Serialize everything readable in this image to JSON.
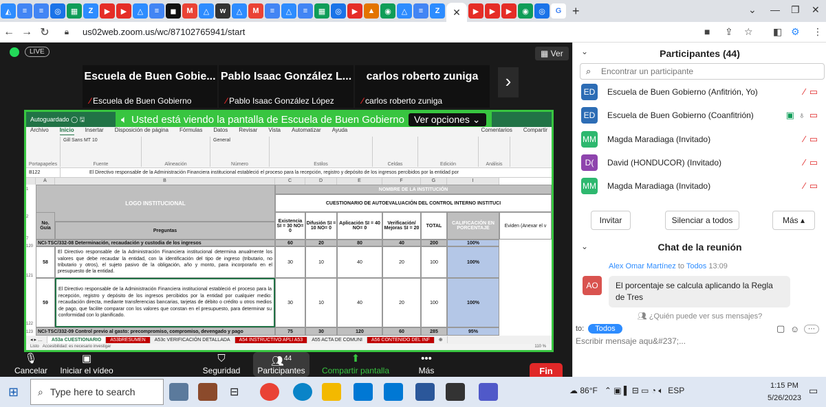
{
  "browser": {
    "url": "us02web.zoom.us/wc/87102765941/start",
    "new_tab": "+"
  },
  "zoom": {
    "live_label": "LIVE",
    "view_label": "Ver",
    "tiles": [
      {
        "big": "Escuela de Buen Gobie...",
        "small": "Escuela de Buen Gobierno"
      },
      {
        "big": "Pablo Isaac González L...",
        "small": "Pablo Isaac González López"
      },
      {
        "big": "carlos roberto zuniga",
        "small": "carlos roberto zuniga"
      }
    ],
    "share_banner": "Usted está viendo la pantalla de Escuela de Buen Gobierno",
    "view_options": "Ver opciones",
    "controls": {
      "mute": "Cancelar silenciar",
      "video": "Iniciar el vídeo",
      "security": "Seguridad",
      "participants": "Participantes",
      "participants_count": "44",
      "share": "Compartir pantalla",
      "more": "Más",
      "end": "Fin"
    }
  },
  "excel": {
    "autosave": "Autoguardado",
    "menu": [
      "Archivo",
      "Inicio",
      "Insertar",
      "Disposición de página",
      "Fórmulas",
      "Datos",
      "Revisar",
      "Vista",
      "Automatizar",
      "Ayuda"
    ],
    "comments": "Comentarios",
    "share": "Compartir",
    "ribbon_groups": [
      "Portapapeles",
      "Fuente",
      "Alineación",
      "Número",
      "Estilos",
      "Celdas",
      "Edición",
      "Análisis"
    ],
    "font_name": "Gill Sans MT",
    "font_size": "10",
    "number_format": "General",
    "cell_ref": "B122",
    "formula": "El Directivo responsable de la Administración Financiera institucional estableció el proceso para la recepción, registro y depósito de los ingresos percibidos por la entidad por",
    "columns": [
      "A",
      "B",
      "C",
      "D",
      "E",
      "F",
      "G",
      "I"
    ],
    "header_institution": "NOMBRE DE LA INSTITUCIÓN",
    "header_logo": "LOGO INSTITUCIONAL",
    "header_cuestionario": "CUESTIONARIO DE AUTOEVALUACIÓN DEL CONTROL INTERNO INSTITUCI",
    "col_headers": [
      "No. Guía",
      "Preguntas",
      "Existencia SI = 30 NO= 0",
      "Difusión SI = 10 NO= 0",
      "Aplicación SI = 40 NO= 0",
      "Verificación/ Mejoras SI = 20",
      "TOTAL",
      "CALIFICACIÓN EN PORCENTAJE",
      "Eviden (Anexar el v"
    ],
    "row_120": {
      "label": "NCI-TSC/332-08 Determinación, recaudación y custodia de los ingresos",
      "c": "60",
      "d": "20",
      "e": "80",
      "f": "40",
      "g": "200",
      "i": "100%"
    },
    "row_121": {
      "num": "58",
      "text": "El Directivo responsable de la Administración Financiera institucional determina anualmente los valores que debe recaudar la entidad, con la identificación del tipo de ingreso (tributario, no tributario y otros), el sujeto pasivo de la obligación, año y monto, para incorporarlo en el presupuesto de la entidad.",
      "c": "30",
      "d": "10",
      "e": "40",
      "f": "20",
      "g": "100",
      "i": "100%"
    },
    "row_122": {
      "num": "59",
      "text": "El Directivo responsable de la Administración Financiera institucional estableció el proceso para la recepción, registro y depósito de los ingresos percibidos por la entidad por cualquier medio: recaudación directa, mediante transferencias bancarias, tarjetas de débito o crédito u otros medios de pago, que facilite comparar con los valores que constan en el presupuesto, para determinar su conformidad con lo planificado.",
      "c": "30",
      "d": "10",
      "e": "40",
      "f": "20",
      "g": "100",
      "i": "100%"
    },
    "row_123": {
      "label": "NCI-TSC/332-09 Control previo al gasto: precompromiso, compromiso, devengado y pago",
      "c": "75",
      "d": "30",
      "e": "120",
      "f": "60",
      "g": "285",
      "i": "95%"
    },
    "row_numbers": [
      "1",
      "2",
      "7",
      "120",
      "121",
      "122",
      "123"
    ],
    "sheets": [
      "A53a CUESTIONARIO",
      "A53bRESUMEN",
      "A53c VERIFICACIÓN DETALLADA",
      "A54 INSTRUCTIVO APLI A53",
      "A55 ACTA DE COMUNI",
      "A56 CONTENIDO DEL INF"
    ],
    "status": "Listo",
    "accessibility": "Accesibilidad: es necesario investigar",
    "zoom_level": "110 %"
  },
  "participants": {
    "title": "Participantes (44)",
    "search_placeholder": "Encontrar un participante",
    "list": [
      {
        "initials": "ED",
        "name": "Escuela de Buen Gobierno (Anfitrión, Yo)",
        "color": "#2d6db5"
      },
      {
        "initials": "ED",
        "name": "Escuela de Buen Gobierno (Coanfitrión)",
        "color": "#2d6db5"
      },
      {
        "initials": "MM",
        "name": "Magda Maradiaga (Invitado)",
        "color": "#2eb86f"
      },
      {
        "initials": "D(",
        "name": "David (HONDUCOR) (Invitado)",
        "color": "#8e44ad"
      },
      {
        "initials": "MM",
        "name": "Magda Maradiaga (Invitado)",
        "color": "#2eb86f"
      }
    ],
    "invite": "Invitar",
    "mute_all": "Silenciar a todos",
    "more": "Más"
  },
  "chat": {
    "title": "Chat de la reunión",
    "sender": "Alex Omar Martínez",
    "to_word": "to",
    "recipient": "Todos",
    "time": "13:09",
    "avatar": "AO",
    "message": "El porcentaje se calcula aplicando la Regla de Tres",
    "who_can_see": "¿Quién puede ver sus mensajes?",
    "to_label": "to:",
    "to_value": "Todos",
    "input_placeholder": "Escribir mensaje aqu&#237;..."
  },
  "taskbar": {
    "search": "Type here to search",
    "weather": "86°F",
    "lang": "ESP",
    "time": "1:15 PM",
    "date": "5/26/2023"
  }
}
